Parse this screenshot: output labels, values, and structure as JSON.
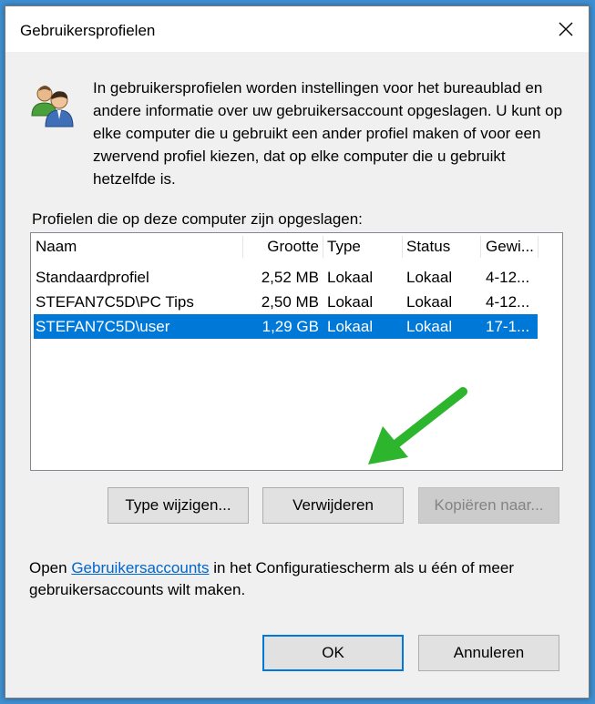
{
  "window": {
    "title": "Gebruikersprofielen"
  },
  "intro_text": "In gebruikersprofielen worden instellingen voor het bureaublad en andere informatie over uw gebruikersaccount opgeslagen. U kunt op elke computer die u gebruikt een ander profiel maken of voor een zwervend profiel kiezen, dat op elke computer die u gebruikt hetzelfde is.",
  "profiles": {
    "label": "Profielen die op deze computer zijn opgeslagen:",
    "columns": [
      "Naam",
      "Grootte",
      "Type",
      "Status",
      "Gewi..."
    ],
    "rows": [
      {
        "name": "Standaardprofiel",
        "size": "2,52 MB",
        "type": "Lokaal",
        "status": "Lokaal",
        "modified": "4-12...",
        "selected": false
      },
      {
        "name": "STEFAN7C5D\\PC Tips",
        "size": "2,50 MB",
        "type": "Lokaal",
        "status": "Lokaal",
        "modified": "4-12...",
        "selected": false
      },
      {
        "name": "STEFAN7C5D\\user",
        "size": "1,29 GB",
        "type": "Lokaal",
        "status": "Lokaal",
        "modified": "17-1...",
        "selected": true
      }
    ]
  },
  "buttons": {
    "change_type": "Type wijzigen...",
    "delete": "Verwijderen",
    "copy_to": "Kopiëren naar...",
    "ok": "OK",
    "cancel": "Annuleren"
  },
  "footer": {
    "before": "Open ",
    "link": "Gebruikersaccounts",
    "after": " in het Configuratiescherm als u één of meer gebruikersaccounts wilt maken."
  },
  "colors": {
    "selection": "#0078d7",
    "link": "#0066cc",
    "annotation_arrow": "#2db52d"
  },
  "icons": {
    "title_close": "close-icon",
    "header": "users-icon",
    "annotation": "green-arrow-icon"
  }
}
